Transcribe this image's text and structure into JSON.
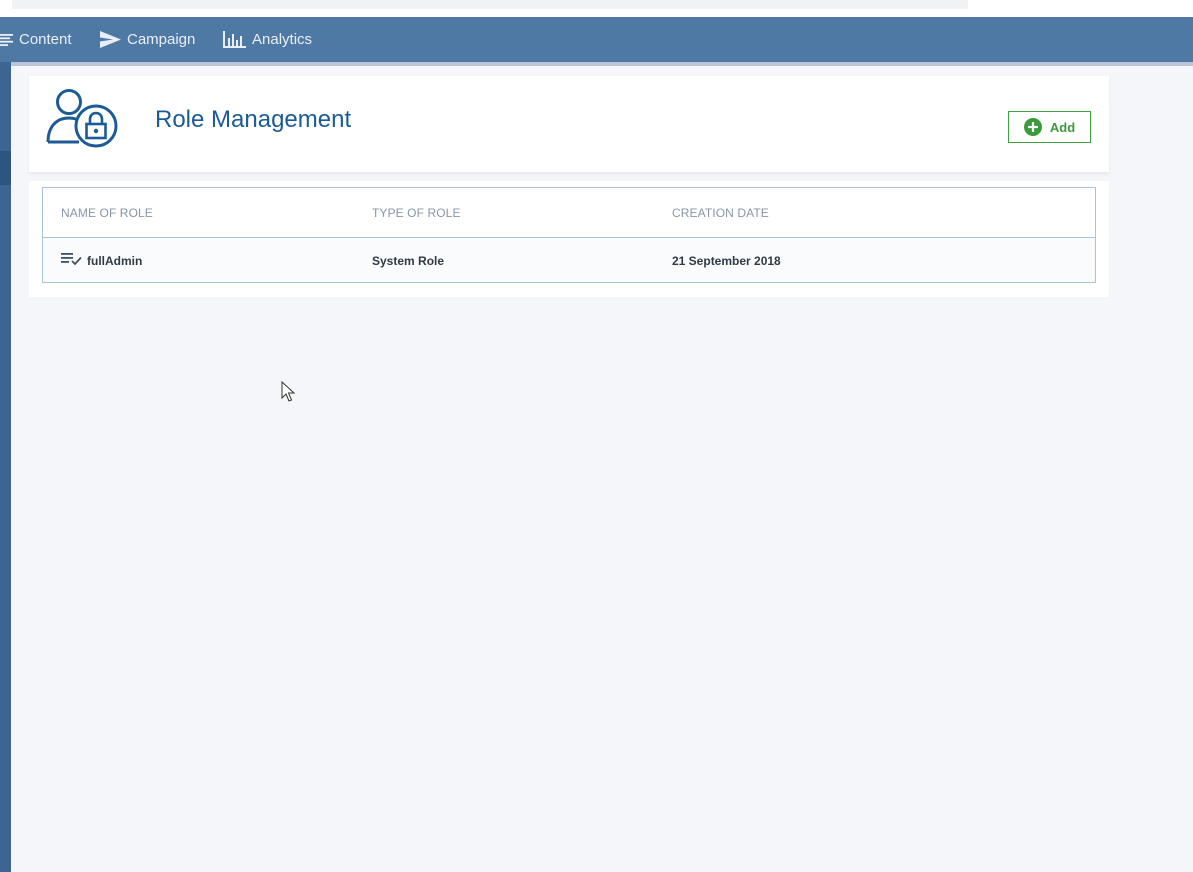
{
  "nav": {
    "items": [
      {
        "label": "Content",
        "icon": "lines-icon"
      },
      {
        "label": "Campaign",
        "icon": "paper-plane-icon"
      },
      {
        "label": "Analytics",
        "icon": "bar-chart-icon"
      }
    ]
  },
  "header": {
    "title": "Role Management",
    "icon": "user-lock-icon",
    "add_label": "Add"
  },
  "table": {
    "columns": [
      "NAME OF ROLE",
      "TYPE OF ROLE",
      "CREATION DATE"
    ],
    "rows": [
      {
        "name": "fullAdmin",
        "type": "System Role",
        "date": "21 September 2018",
        "icon": "list-check-icon"
      }
    ]
  },
  "colors": {
    "nav_bg": "#4f79a5",
    "title": "#1c5b96",
    "add_accent": "#3fa041",
    "background": "#f4f6fa"
  }
}
